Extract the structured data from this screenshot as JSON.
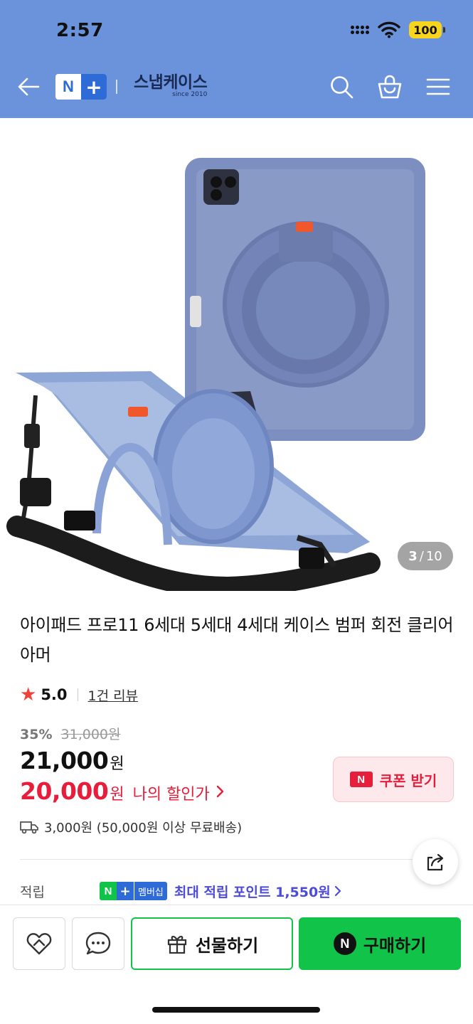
{
  "status_bar": {
    "time": "2:57",
    "battery": "100"
  },
  "header": {
    "nplus_n": "N",
    "nplus_plus": "+",
    "brand_name": "스냅케이스",
    "brand_sub": "since 2010",
    "icons": [
      "back-arrow-icon",
      "search-icon",
      "shopping-bag-icon",
      "menu-icon"
    ],
    "colors": {
      "bar": "#6b93dc",
      "brand_blue": "#2e6bd6"
    }
  },
  "gallery": {
    "current": "3",
    "separator": "/",
    "total": "10"
  },
  "product": {
    "title": "아이패드 프로11 6세대 5세대 4세대 케이스 범퍼 회전 클리어 아머",
    "rating": "5.0",
    "review_link": "1건 리뷰",
    "discount_rate": "35%",
    "original_price": "31,000원",
    "price": "21,000",
    "price_unit": "원",
    "my_price": "20,000",
    "my_price_unit": "원",
    "my_price_label": "나의 할인가",
    "shipping": "3,000원 (50,000원 이상 무료배송)"
  },
  "coupon": {
    "badge": "N",
    "label": "쿠폰 받기",
    "color": "#e61e3c"
  },
  "points": {
    "label": "적립",
    "badge_n": "N",
    "badge_plus": "+",
    "badge_text": "멤버십",
    "text": "최대 적립 포인트 1,550원",
    "color": "#4e4bd6"
  },
  "bottom_bar": {
    "gift_label": "선물하기",
    "buy_badge": "N",
    "buy_label": "구매하기",
    "buy_color": "#12c34a"
  }
}
